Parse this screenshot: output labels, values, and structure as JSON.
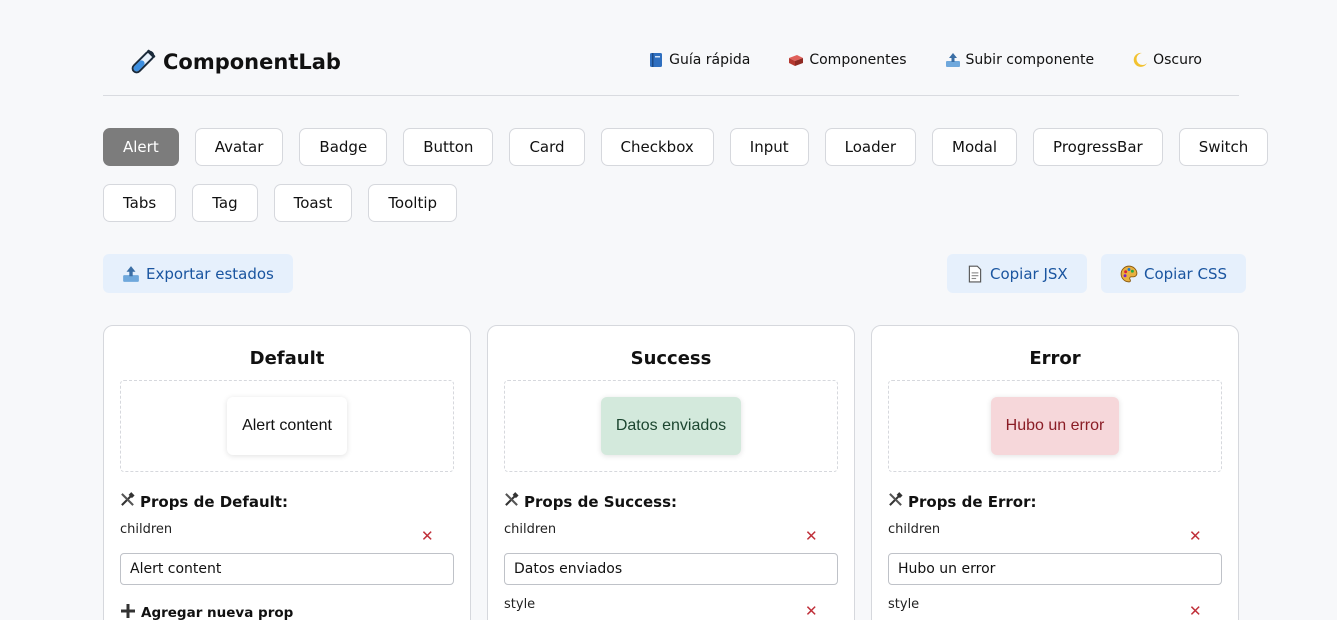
{
  "header": {
    "title": "ComponentLab",
    "nav": [
      {
        "label": "Guía rápida",
        "icon": "book-icon"
      },
      {
        "label": "Componentes",
        "icon": "brick-icon"
      },
      {
        "label": "Subir componente",
        "icon": "outbox-tray-icon"
      },
      {
        "label": "Oscuro",
        "icon": "crescent-moon-icon"
      }
    ]
  },
  "components": [
    "Alert",
    "Avatar",
    "Badge",
    "Button",
    "Card",
    "Checkbox",
    "Input",
    "Loader",
    "Modal",
    "ProgressBar",
    "Switch",
    "Tabs",
    "Tag",
    "Toast",
    "Tooltip"
  ],
  "active_component": "Alert",
  "actions": {
    "export": "Exportar estados",
    "copy_jsx": "Copiar JSX",
    "copy_css": "Copiar CSS"
  },
  "colors": {
    "accent": "#1a55a0",
    "action_bg": "#e6f0fc",
    "active_chip": "#7c7c7c"
  },
  "states": [
    {
      "title": "Default",
      "preview_text": "Alert content",
      "preview_bg": "#ffffff",
      "preview_fg": "#111111",
      "props_title": "Props de Default:",
      "props": [
        {
          "name": "children",
          "value": "Alert content"
        }
      ],
      "add_prop": "Agregar nueva prop"
    },
    {
      "title": "Success",
      "preview_text": "Datos enviados",
      "preview_bg": "#d3e9dc",
      "preview_fg": "#1c4630",
      "props_title": "Props de Success:",
      "props": [
        {
          "name": "children",
          "value": "Datos enviados"
        },
        {
          "name": "style",
          "value": ""
        }
      ]
    },
    {
      "title": "Error",
      "preview_text": "Hubo un error",
      "preview_bg": "#f6d7da",
      "preview_fg": "#8a1c25",
      "props_title": "Props de Error:",
      "props": [
        {
          "name": "children",
          "value": "Hubo un error"
        },
        {
          "name": "style",
          "value": ""
        }
      ]
    }
  ]
}
